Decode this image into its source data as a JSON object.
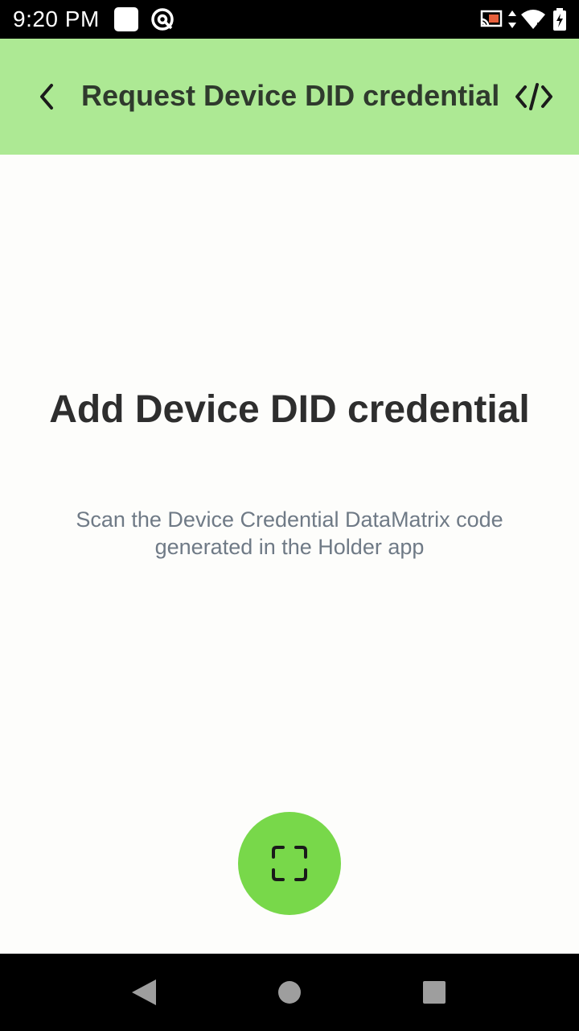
{
  "status_bar": {
    "time": "9:20 PM",
    "icons": [
      "square-notification-icon",
      "at-sign-icon",
      "cast-icon",
      "data-arrows-icon",
      "wifi-icon",
      "battery-charging-icon"
    ]
  },
  "app_bar": {
    "back_icon": "chevron-left-icon",
    "title": "Request Device DID credential",
    "code_icon": "code-icon",
    "background": "#ade994"
  },
  "main": {
    "heading": "Add Device DID credential",
    "description": "Scan the Device Credential DataMatrix code generated in the Holder app"
  },
  "fab": {
    "icon": "scan-frame-icon",
    "color": "#78d84a"
  },
  "nav_bar": {
    "icons": [
      "back-triangle-icon",
      "home-circle-icon",
      "recents-square-icon"
    ]
  }
}
